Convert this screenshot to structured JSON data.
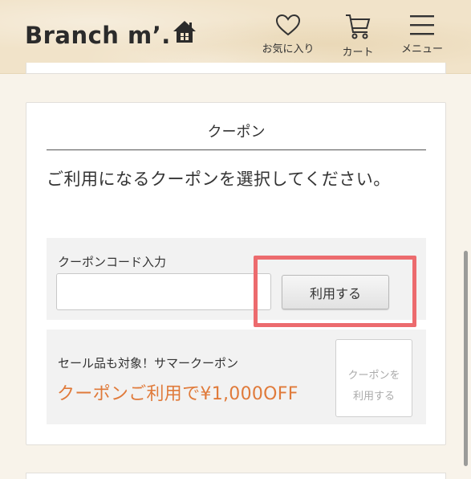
{
  "header": {
    "logo_text": "Branch m’.",
    "nav": {
      "favorites_label": "お気に入り",
      "cart_label": "カート",
      "menu_label": "メニュー"
    }
  },
  "coupon_card": {
    "title": "クーポン",
    "description": "ご利用になるクーポンを選択してください。",
    "code_entry": {
      "label": "クーポンコード入力",
      "input_value": "",
      "input_placeholder": "",
      "apply_button_label": "利用する"
    },
    "available_coupon": {
      "name": "セール品も対象！サマークーポン",
      "offer": "クーポンご利用で¥1,000OFF",
      "use_button_line1": "クーポンを",
      "use_button_line2": "利用する"
    }
  },
  "colors": {
    "header_bg": "#f1e3c9",
    "page_bg": "#f8f3ea",
    "highlight": "#ec6b6e",
    "offer_text": "#e07a3a",
    "disabled_text": "#aaaaaa"
  }
}
